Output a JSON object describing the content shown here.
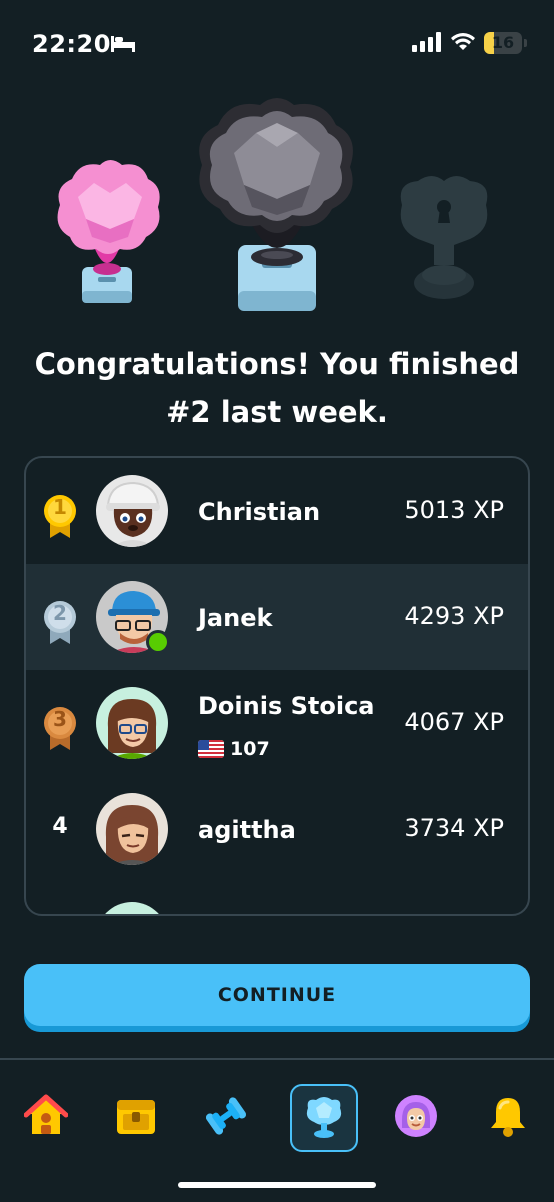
{
  "status_bar": {
    "time": "22:20",
    "battery": "16",
    "battery_level": 0.16
  },
  "headline": {
    "line1": "Congratulations! You finished",
    "line2": "#2 last week."
  },
  "leaderboard": [
    {
      "rank": "1",
      "name": "Christian",
      "xp": "5013 XP"
    },
    {
      "rank": "2",
      "name": "Janek",
      "xp": "4293 XP"
    },
    {
      "rank": "3",
      "name": "Doinis Stoica",
      "xp": "4067 XP",
      "streak": "107"
    },
    {
      "rank": "4",
      "name": "agittha",
      "xp": "3734 XP"
    }
  ],
  "continue_label": "CONTINUE",
  "colors": {
    "background": "#131f24",
    "accent": "#49c0f8",
    "highlight_row": "#202f36",
    "online": "#58cc02"
  },
  "tabs": [
    "home-icon",
    "chest-icon",
    "dumbbell-icon",
    "trophy-icon",
    "profile-icon",
    "bell-icon"
  ]
}
